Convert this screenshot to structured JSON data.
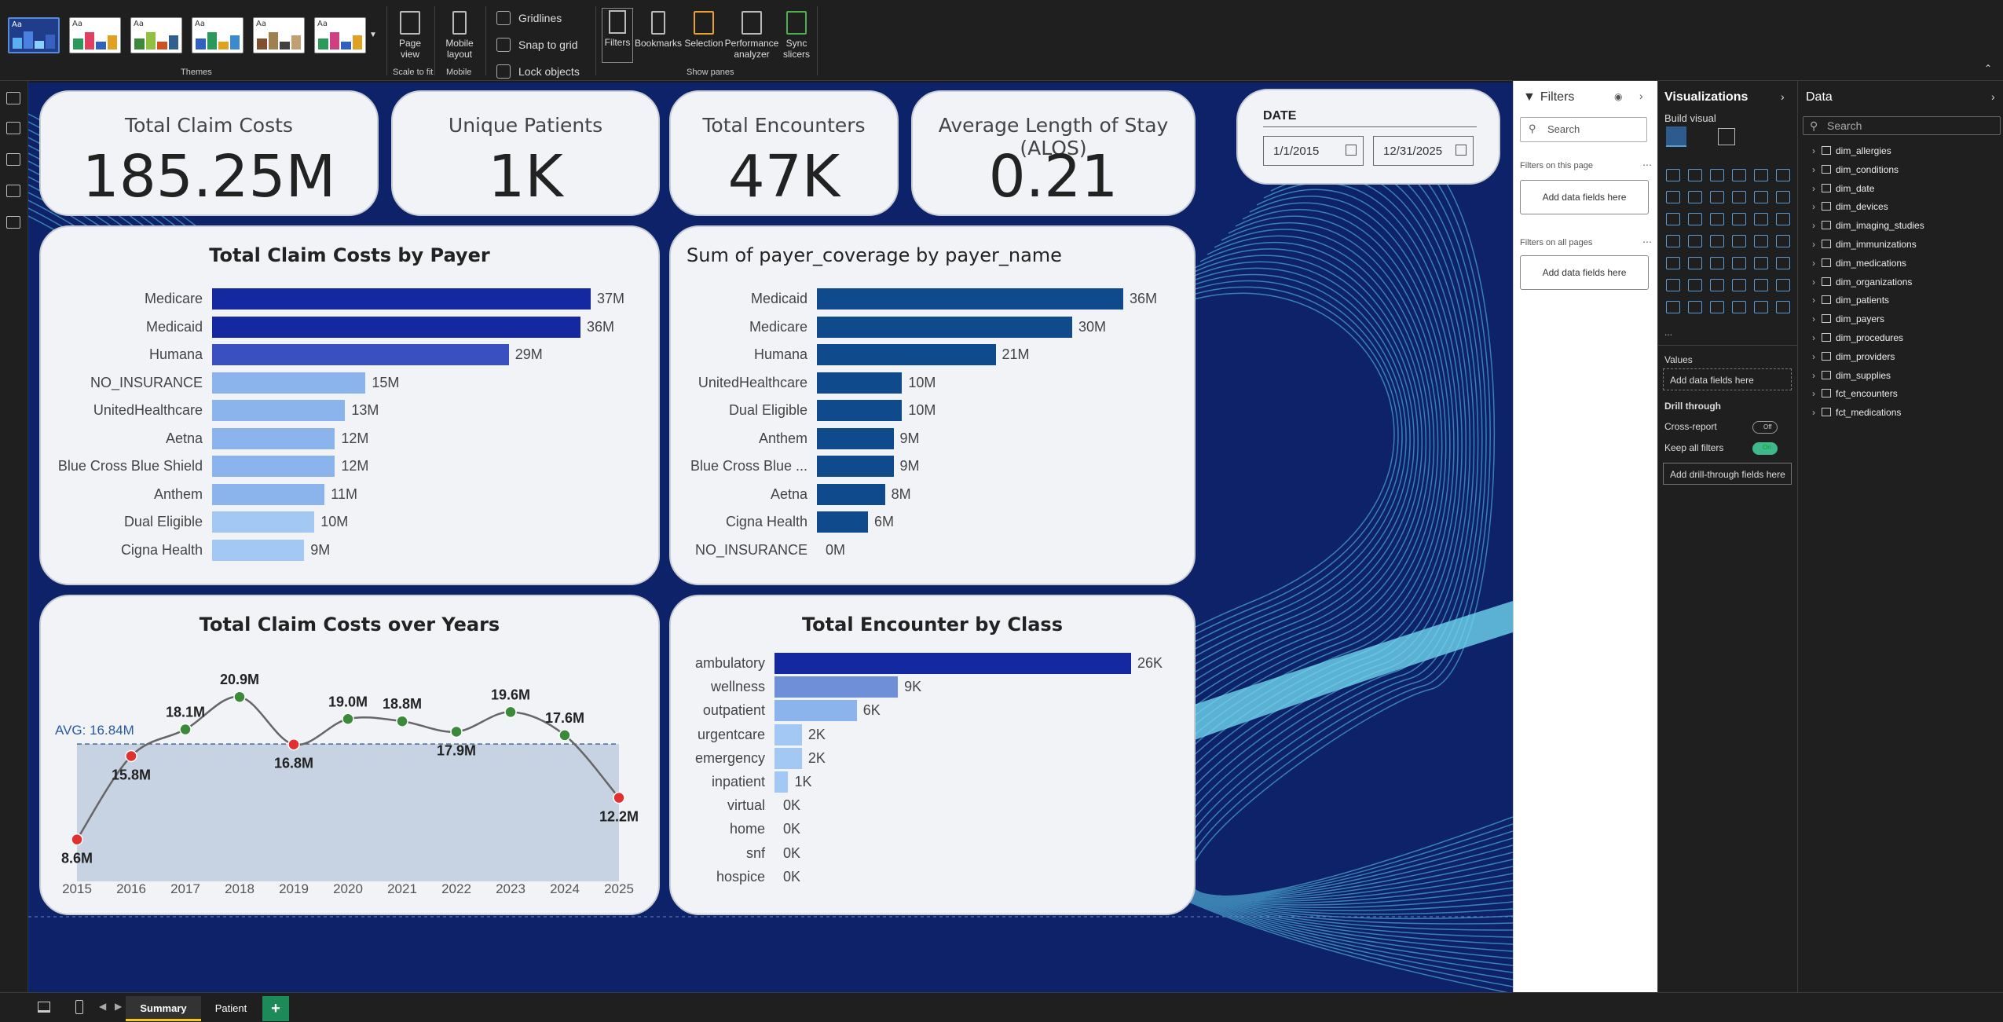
{
  "ribbon": {
    "groups": {
      "themes": "Themes",
      "scale_to_fit": "Scale to fit",
      "mobile": "Mobile",
      "show_panes": "Show panes"
    },
    "page_view": "Page view",
    "mobile_layout": "Mobile layout",
    "checkboxes": {
      "gridlines": "Gridlines",
      "snap": "Snap to grid",
      "lock": "Lock objects"
    },
    "panes": {
      "filters": "Filters",
      "bookmarks": "Bookmarks",
      "selection": "Selection",
      "performance": "Performance analyzer",
      "sync": "Sync slicers"
    },
    "theme_aa": "Aa"
  },
  "kpis": {
    "claim_costs": {
      "title": "Total Claim Costs",
      "value": "185.25M"
    },
    "unique_patients": {
      "title": "Unique Patients",
      "value": "1K"
    },
    "encounters": {
      "title": "Total Encounters",
      "value": "47K"
    },
    "alos": {
      "title": "Average Length of Stay (ALOS)",
      "value": "0.21"
    }
  },
  "date_slicer": {
    "title": "DATE",
    "start": "1/1/2015",
    "end": "12/31/2025"
  },
  "charts": {
    "claims_by_payer": {
      "title": "Total Claim Costs by Payer",
      "type": "bar",
      "categories": [
        "Medicare",
        "Medicaid",
        "Humana",
        "NO_INSURANCE",
        "UnitedHealthcare",
        "Aetna",
        "Blue Cross Blue Shield",
        "Anthem",
        "Dual Eligible",
        "Cigna Health"
      ],
      "values": [
        37,
        36,
        29,
        15,
        13,
        12,
        12,
        11,
        10,
        9
      ],
      "labels": [
        "37M",
        "36M",
        "29M",
        "15M",
        "13M",
        "12M",
        "12M",
        "11M",
        "10M",
        "9M"
      ],
      "colors": [
        "#1428a0",
        "#1428a0",
        "#3a50c0",
        "#8bb4ec",
        "#8bb4ec",
        "#8bb4ec",
        "#8bb4ec",
        "#8bb4ec",
        "#a3c8f4",
        "#a3c8f4"
      ],
      "max": 37
    },
    "coverage_by_payer": {
      "title": "Sum of payer_coverage by payer_name",
      "type": "bar",
      "categories": [
        "Medicaid",
        "Medicare",
        "Humana",
        "UnitedHealthcare",
        "Dual Eligible",
        "Anthem",
        "Blue Cross Blue ...",
        "Aetna",
        "Cigna Health",
        "NO_INSURANCE"
      ],
      "values": [
        36,
        30,
        21,
        10,
        10,
        9,
        9,
        8,
        6,
        0
      ],
      "labels": [
        "36M",
        "30M",
        "21M",
        "10M",
        "10M",
        "9M",
        "9M",
        "8M",
        "6M",
        "0M"
      ],
      "color": "#0f4a8c",
      "max": 36
    },
    "claims_over_years": {
      "title": "Total Claim Costs over Years",
      "type": "line",
      "x": [
        "2015",
        "2016",
        "2017",
        "2018",
        "2019",
        "2020",
        "2021",
        "2022",
        "2023",
        "2024",
        "2025"
      ],
      "values": [
        8.6,
        15.8,
        18.1,
        20.9,
        16.8,
        19.0,
        18.8,
        17.9,
        19.6,
        17.6,
        12.2
      ],
      "labels": [
        "8.6M",
        "15.8M",
        "18.1M",
        "20.9M",
        "16.8M",
        "19.0M",
        "18.8M",
        "17.9M",
        "19.6M",
        "17.6M",
        "12.2M"
      ],
      "avg": 16.84,
      "avg_label": "AVG: 16.84M",
      "colors": {
        "above": "#3a8a3a",
        "below": "#e03030",
        "line": "#666666",
        "band": "#c7d3e2"
      }
    },
    "encounter_by_class": {
      "title": "Total Encounter by Class",
      "type": "bar",
      "categories": [
        "ambulatory",
        "wellness",
        "outpatient",
        "urgentcare",
        "emergency",
        "inpatient",
        "virtual",
        "home",
        "snf",
        "hospice"
      ],
      "values": [
        26,
        9,
        6,
        2,
        2,
        1,
        0,
        0,
        0,
        0
      ],
      "labels": [
        "26K",
        "9K",
        "6K",
        "2K",
        "2K",
        "1K",
        "0K",
        "0K",
        "0K",
        "0K"
      ],
      "colors": [
        "#1428a0",
        "#6f8fd8",
        "#8bb4ec",
        "#a3c8f4",
        "#a3c8f4",
        "#a3c8f4",
        "#a3c8f4",
        "#a3c8f4",
        "#a3c8f4",
        "#a3c8f4"
      ],
      "max": 26
    }
  },
  "filters": {
    "title": "Filters",
    "search": "Search",
    "on_page": "Filters on this page",
    "on_all": "Filters on all pages",
    "add": "Add data fields here"
  },
  "viz": {
    "title": "Visualizations",
    "build": "Build visual",
    "values": "Values",
    "add": "Add data fields here",
    "drill": "Drill through",
    "cross": "Cross-report",
    "cross_state": "Off",
    "keep": "Keep all filters",
    "keep_state": "On",
    "add_drill": "Add drill-through fields here",
    "more": "..."
  },
  "data": {
    "title": "Data",
    "search": "Search",
    "tables": [
      "dim_allergies",
      "dim_conditions",
      "dim_date",
      "dim_devices",
      "dim_imaging_studies",
      "dim_immunizations",
      "dim_medications",
      "dim_organizations",
      "dim_patients",
      "dim_payers",
      "dim_procedures",
      "dim_providers",
      "dim_supplies",
      "fct_encounters",
      "fct_medications"
    ]
  },
  "tabs": {
    "summary": "Summary",
    "patient": "Patient",
    "add": "+"
  }
}
